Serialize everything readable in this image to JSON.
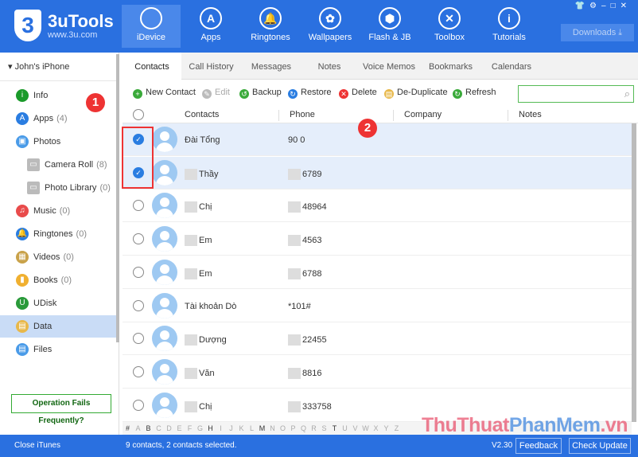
{
  "app": {
    "logo_char": "3",
    "name": "3uTools",
    "url": "www.3u.com",
    "downloads": "Downloads ⤓",
    "window_controls": "👕⚙–□✕"
  },
  "nav": [
    {
      "label": "iDevice",
      "icon": ""
    },
    {
      "label": "Apps",
      "icon": "A"
    },
    {
      "label": "Ringtones",
      "icon": "🔔"
    },
    {
      "label": "Wallpapers",
      "icon": "✿"
    },
    {
      "label": "Flash & JB",
      "icon": "⬢"
    },
    {
      "label": "Toolbox",
      "icon": "✕"
    },
    {
      "label": "Tutorials",
      "icon": "i"
    }
  ],
  "sidebar": {
    "device": "▾  John's iPhone",
    "items": [
      {
        "label": "Info",
        "count": "",
        "icon": "i",
        "color": "#1a9a2a",
        "sub": false
      },
      {
        "label": "Apps",
        "count": "(4)",
        "icon": "A",
        "color": "#2a7de1",
        "sub": false
      },
      {
        "label": "Photos",
        "count": "",
        "icon": "▣",
        "color": "#4a9be8",
        "sub": false
      },
      {
        "label": "Camera Roll",
        "count": "(8)",
        "icon": "▭",
        "color": "#bbb",
        "sub": true
      },
      {
        "label": "Photo Library",
        "count": "(0)",
        "icon": "▭",
        "color": "#bbb",
        "sub": true
      },
      {
        "label": "Music",
        "count": "(0)",
        "icon": "♫",
        "color": "#e94b4b",
        "sub": false
      },
      {
        "label": "Ringtones",
        "count": "(0)",
        "icon": "🔔",
        "color": "#2a7de1",
        "sub": false
      },
      {
        "label": "Videos",
        "count": "(0)",
        "icon": "▦",
        "color": "#c9a24a",
        "sub": false
      },
      {
        "label": "Books",
        "count": "(0)",
        "icon": "▮",
        "color": "#f0b030",
        "sub": false
      },
      {
        "label": "UDisk",
        "count": "",
        "icon": "U",
        "color": "#2a9a3a",
        "sub": false
      },
      {
        "label": "Data",
        "count": "",
        "icon": "▤",
        "color": "#e8b84a",
        "sub": false,
        "selected": true
      },
      {
        "label": "Files",
        "count": "",
        "icon": "▤",
        "color": "#4a9be8",
        "sub": false
      }
    ],
    "op_fails": "Operation Fails Frequently?",
    "close_itunes": "Close iTunes"
  },
  "tabs": [
    "Contacts",
    "Call History",
    "Messages",
    "Notes",
    "Voice Memos",
    "Bookmarks",
    "Calendars"
  ],
  "toolbar": [
    {
      "label": "New Contact",
      "icon": "+",
      "color": "#3aaa3a"
    },
    {
      "label": "Edit",
      "icon": "✎",
      "color": "#bbb",
      "disabled": true
    },
    {
      "label": "Backup",
      "icon": "↺",
      "color": "#3aaa3a"
    },
    {
      "label": "Restore",
      "icon": "↻",
      "color": "#2a7de1"
    },
    {
      "label": "Delete",
      "icon": "✕",
      "color": "#e33"
    },
    {
      "label": "De-Duplicate",
      "icon": "▤",
      "color": "#e8b84a"
    },
    {
      "label": "Refresh",
      "icon": "↻",
      "color": "#3aaa3a"
    }
  ],
  "columns": {
    "contacts": "Contacts",
    "phone": "Phone",
    "company": "Company",
    "notes": "Notes"
  },
  "contacts": [
    {
      "name": "Đài Tổng",
      "phone": "90 0",
      "selected": true,
      "blurred": false
    },
    {
      "name": "Thầy",
      "phone": "6789",
      "selected": true,
      "blurred": true
    },
    {
      "name": "Chị",
      "phone": "48964",
      "selected": false,
      "blurred": true
    },
    {
      "name": "Em",
      "phone": "4563",
      "selected": false,
      "blurred": true
    },
    {
      "name": "Em",
      "phone": "6788",
      "selected": false,
      "blurred": true
    },
    {
      "name": "Tài khoản Dò",
      "phone": "*101#",
      "selected": false,
      "blurred": false
    },
    {
      "name": "Dượng",
      "phone": "22455",
      "selected": false,
      "blurred": true
    },
    {
      "name": "Văn",
      "phone": "8816",
      "selected": false,
      "blurred": true
    },
    {
      "name": "Chị",
      "phone": "333758",
      "selected": false,
      "blurred": true
    }
  ],
  "alphabet": [
    "#",
    "A",
    "B",
    "C",
    "D",
    "E",
    "F",
    "G",
    "H",
    "I",
    "J",
    "K",
    "L",
    "M",
    "N",
    "O",
    "P",
    "Q",
    "R",
    "S",
    "T",
    "U",
    "V",
    "W",
    "X",
    "Y",
    "Z"
  ],
  "alphabet_active": [
    "B",
    "H",
    "M",
    "T"
  ],
  "annotations": [
    "1",
    "2"
  ],
  "status": {
    "text": "9 contacts, 2 contacts selected.",
    "version": "V2.30",
    "feedback": "Feedback",
    "check_update": "Check Update"
  },
  "watermark": {
    "a": "ThuThuat",
    "b": "PhanMem",
    "c": ".vn"
  }
}
